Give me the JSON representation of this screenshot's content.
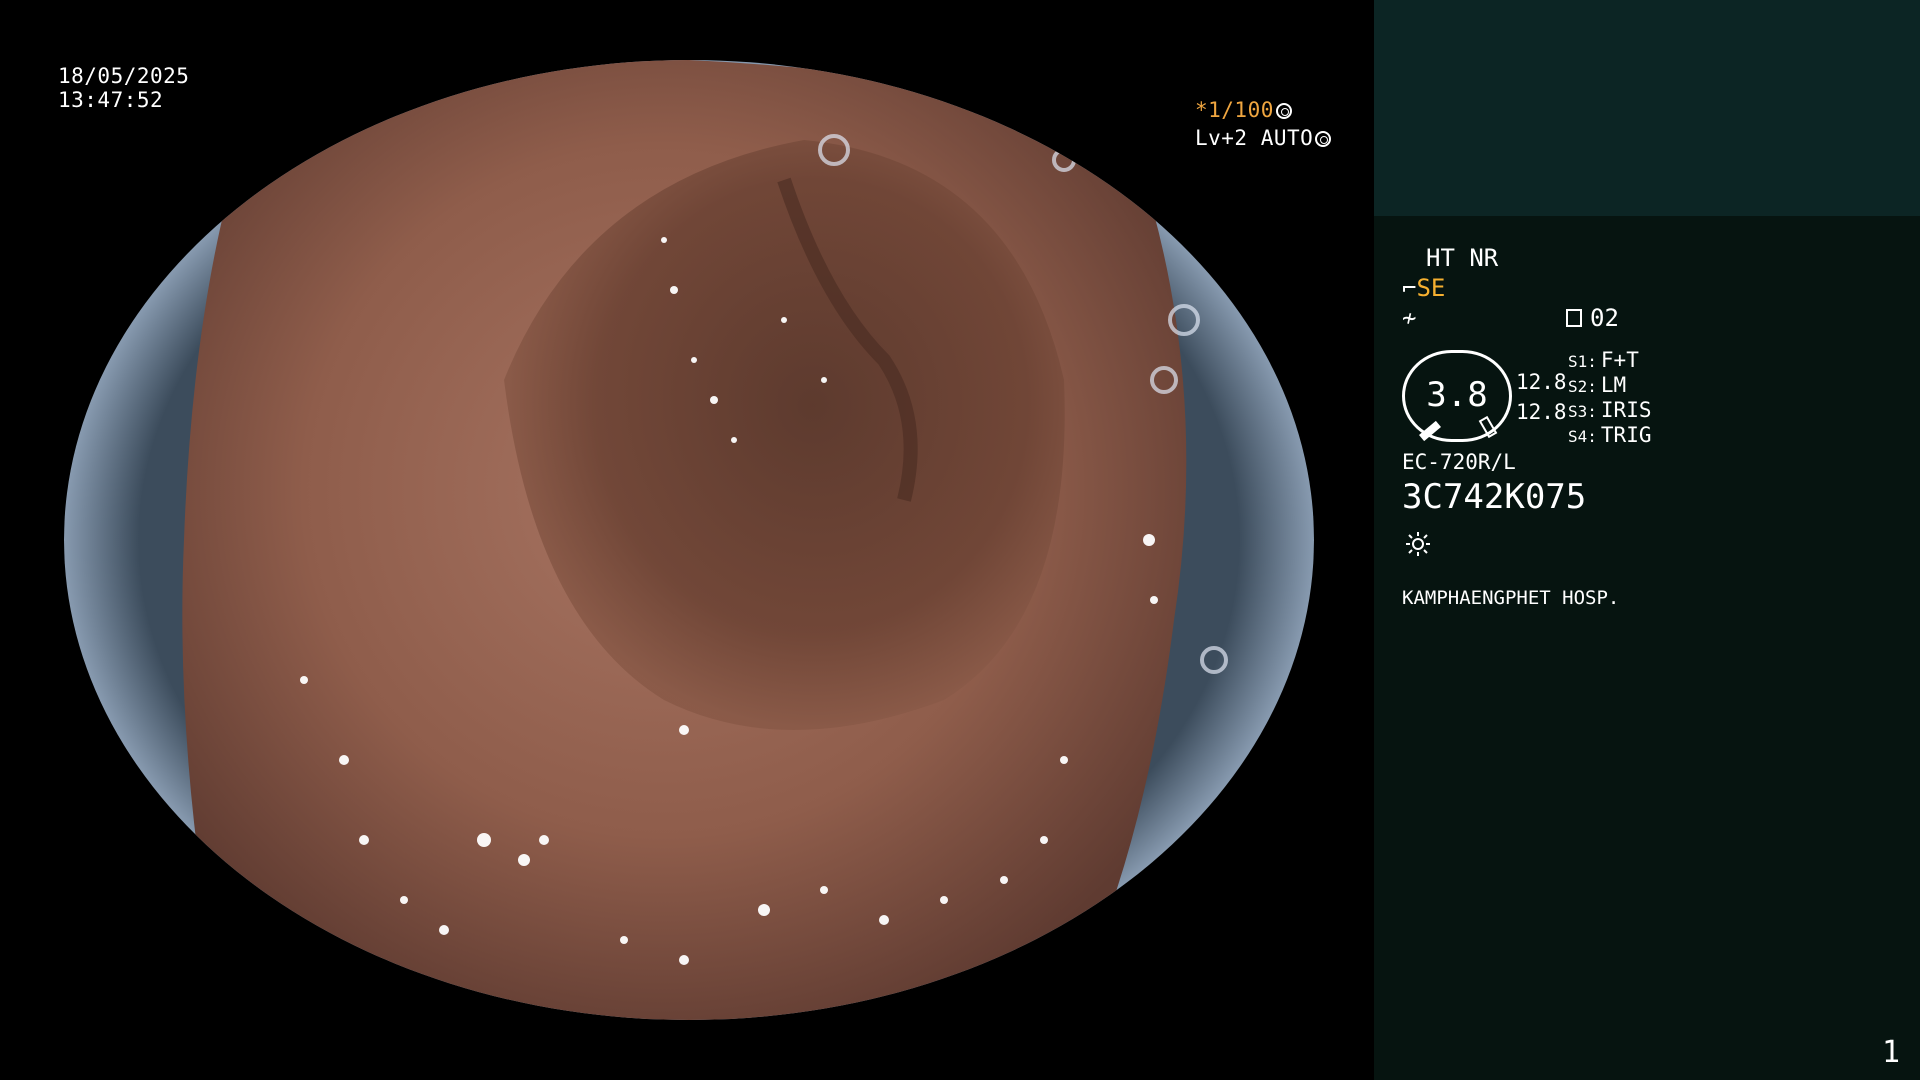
{
  "overlay": {
    "date": "18/05/2025",
    "time": "13:47:52",
    "shutter_prefix": "*1/100",
    "level": "Lv+2 AUTO",
    "shutter_icon": "aperture-icon",
    "level_icon": "iris-icon"
  },
  "panel": {
    "mode_line": "HT NR",
    "enhance_label": "SE",
    "enhance_icon": "enhance-icon",
    "nf_icon": "noise-filter-icon",
    "memo_icon": "memory-icon",
    "memo_value": "02",
    "gauge_value": "3.8",
    "gauge_val_1": "12.8",
    "gauge_val_2": "12.8",
    "switches": [
      {
        "key": "S1:",
        "value": "F+T"
      },
      {
        "key": "S2:",
        "value": "LM"
      },
      {
        "key": "S3:",
        "value": "IRIS"
      },
      {
        "key": "S4:",
        "value": "TRIG"
      }
    ],
    "scope_model": "EC-720R/L",
    "scope_serial": "3C742K075",
    "light_icon": "light-source-icon",
    "hospital": "KAMPHAENGPHET HOSP.",
    "page_number": "1"
  },
  "colors": {
    "panel_bg": "#061410",
    "panel_top_bg": "#0c2524",
    "accent_orange": "#f0a640",
    "mucosa": "#8a5a48"
  }
}
